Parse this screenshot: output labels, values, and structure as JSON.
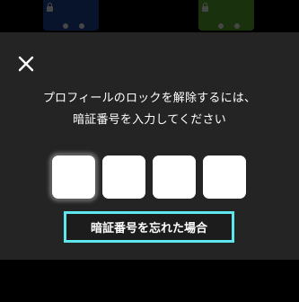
{
  "background": {
    "profiles": [
      {
        "color": "#1b3f86",
        "icon": "lock-icon"
      },
      {
        "color": "#4f9a2a",
        "icon": "lock-icon"
      }
    ]
  },
  "dialog": {
    "close_icon": "close-icon",
    "prompt_line1": "プロフィールのロックを解除するには、",
    "prompt_line2": "暗証番号を入力してください",
    "pin_length": 4,
    "pin_values": [
      "",
      "",
      "",
      ""
    ],
    "forgot_pin_label": "暗証番号を忘れた場合",
    "highlight_color": "#5fe6ec"
  }
}
